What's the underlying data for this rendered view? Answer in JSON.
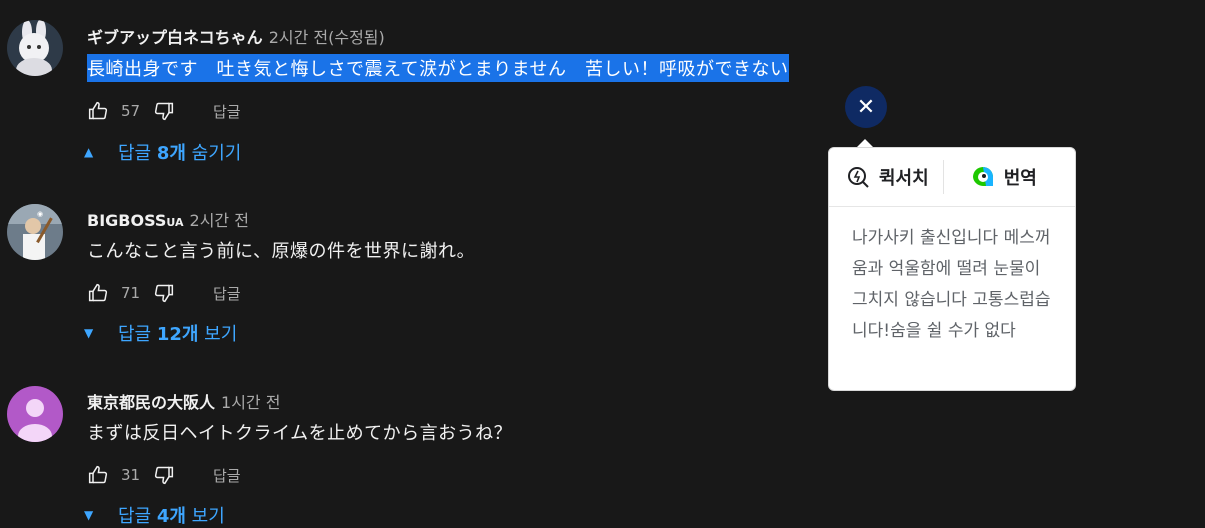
{
  "comments": [
    {
      "author": "ギブアップ白ネコちゃん",
      "time": "2시간 전(수정됨)",
      "text": "長崎出身です　吐き気と悔しさで震えて涙がとまりません　苦しい！呼吸ができない",
      "likes": "57",
      "reply_label": "답글",
      "replies_prefix": "답글 ",
      "replies_count": "8개",
      "replies_action": " 숨기기",
      "avatar": "white-cat-plush-avatar"
    },
    {
      "author": "BIGBOSS",
      "author_suffix": "UA",
      "time": "2시간 전",
      "text": "こんなこと言う前に、原爆の件を世界に謝れ。",
      "likes": "71",
      "reply_label": "답글",
      "replies_prefix": "답글 ",
      "replies_count": "12개",
      "replies_action": " 보기",
      "avatar": "baseball-player-avatar"
    },
    {
      "author": "東京都民の大阪人",
      "time": "1시간 전",
      "text": "まずは反日ヘイトクライムを止めてから言おうね？",
      "likes": "31",
      "reply_label": "답글",
      "replies_prefix": "답글 ",
      "replies_count": "4개",
      "replies_action": " 보기",
      "avatar": "default-purple-avatar"
    }
  ],
  "popup": {
    "close_icon": "close-x-icon",
    "tabs": [
      {
        "label": "퀵서치",
        "icon": "quick-search-icon"
      },
      {
        "label": "번역",
        "icon": "papago-translate-icon"
      }
    ],
    "translation": "나가사키 출신입니다 메스꺼움과 억울함에 떨려 눈물이 그치지 않습니다 고통스럽습니다!숨을 쉴 수가 없다"
  },
  "colors": {
    "background": "#181818",
    "link": "#3ea6ff",
    "selection": "#1a73e8",
    "popup_close": "#0f2a63",
    "avatar_purple": "#b259c8"
  }
}
